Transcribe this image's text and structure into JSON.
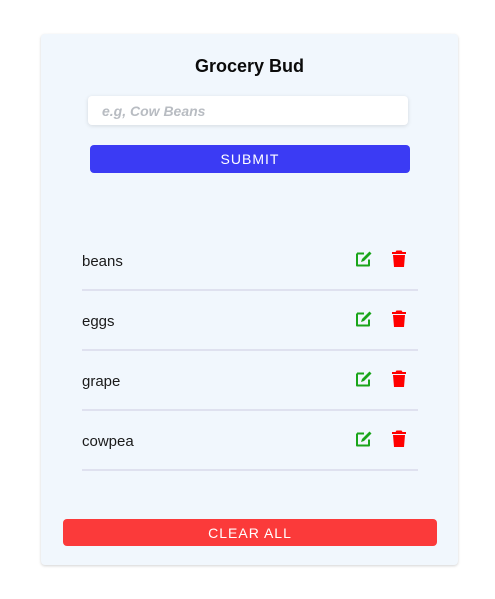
{
  "app": {
    "title": "Grocery Bud"
  },
  "form": {
    "input_value": "",
    "input_placeholder": "e.g, Cow Beans",
    "submit_label": "SUBMIT"
  },
  "items": [
    {
      "label": "beans"
    },
    {
      "label": "eggs"
    },
    {
      "label": "grape"
    },
    {
      "label": "cowpea"
    }
  ],
  "icons": {
    "edit": "edit-icon",
    "delete": "trash-icon"
  },
  "actions": {
    "clear_label": "CLEAR ALL"
  },
  "colors": {
    "card_bg": "#f1f7fd",
    "submit_bg": "#3b3bf4",
    "clear_bg": "#fb3a3a",
    "edit_icon": "#1aa51a",
    "delete_icon": "#ff0000",
    "divider": "#dfe1ef"
  }
}
